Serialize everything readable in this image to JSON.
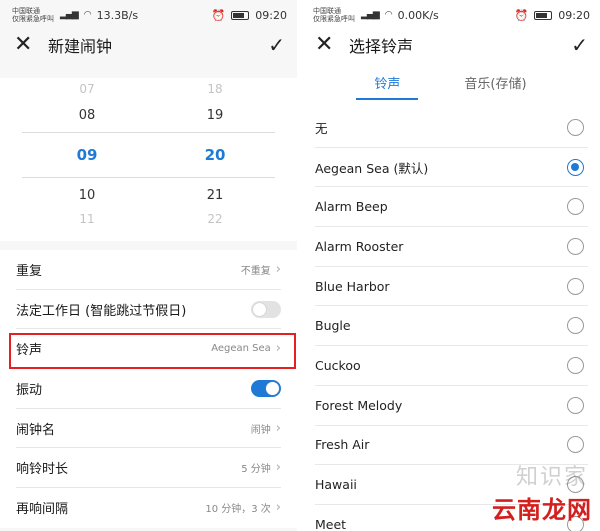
{
  "left": {
    "status": {
      "carrier1": "中国联通",
      "carrier2": "仅限紧急呼叫",
      "net": "13.3B/s",
      "time": "09:20"
    },
    "header": {
      "title": "新建闹钟"
    },
    "picker": {
      "hours": [
        "07",
        "08",
        "09",
        "10",
        "11"
      ],
      "minutes": [
        "18",
        "19",
        "20",
        "21",
        "22"
      ]
    },
    "settings": {
      "repeat_label": "重复",
      "repeat_value": "不重复",
      "workday_label": "法定工作日 (智能跳过节假日)",
      "ringtone_label": "铃声",
      "ringtone_value": "Aegean Sea",
      "vibrate_label": "振动",
      "name_label": "闹钟名",
      "name_value": "闹钟",
      "duration_label": "响铃时长",
      "duration_value": "5 分钟",
      "snooze_label": "再响间隔",
      "snooze_value": "10 分钟，3 次"
    }
  },
  "right": {
    "status": {
      "carrier1": "中国联通",
      "carrier2": "仅限紧急呼叫",
      "net": "0.00K/s",
      "time": "09:20"
    },
    "header": {
      "title": "选择铃声"
    },
    "tabs": {
      "ringtone": "铃声",
      "music": "音乐(存储)"
    },
    "items": [
      "无",
      "Aegean Sea (默认)",
      "Alarm Beep",
      "Alarm Rooster",
      "Blue Harbor",
      "Bugle",
      "Cuckoo",
      "Forest Melody",
      "Fresh Air",
      "Hawaii",
      "Meet"
    ]
  },
  "watermark": {
    "top": "知识家",
    "bottom": "云南龙网"
  },
  "colors": {
    "accent": "#1f7ad6",
    "highlight": "#e62020"
  }
}
